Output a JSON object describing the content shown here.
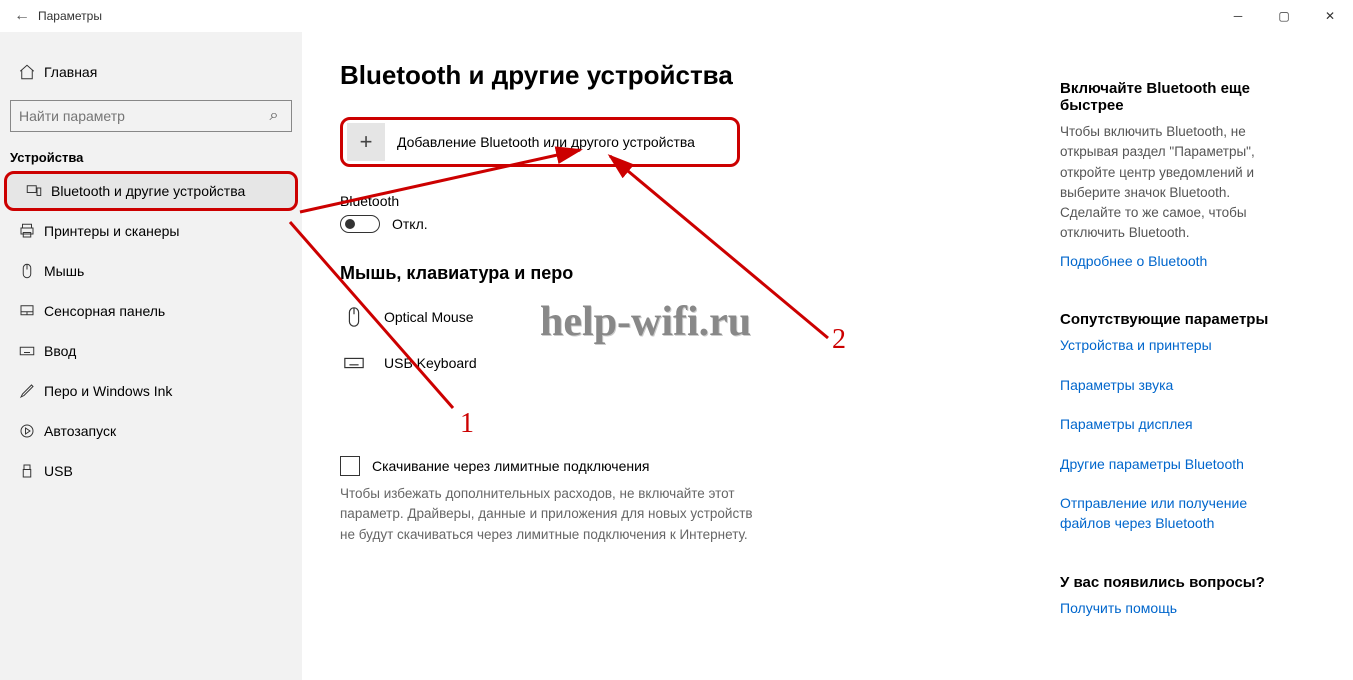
{
  "window": {
    "title": "Параметры"
  },
  "sidebar": {
    "home": "Главная",
    "search_placeholder": "Найти параметр",
    "category": "Устройства",
    "items": [
      {
        "label": "Bluetooth и другие устройства",
        "icon": "devices"
      },
      {
        "label": "Принтеры и сканеры",
        "icon": "printer"
      },
      {
        "label": "Мышь",
        "icon": "mouse"
      },
      {
        "label": "Сенсорная панель",
        "icon": "touchpad"
      },
      {
        "label": "Ввод",
        "icon": "keyboard"
      },
      {
        "label": "Перо и Windows Ink",
        "icon": "pen"
      },
      {
        "label": "Автозапуск",
        "icon": "autoplay"
      },
      {
        "label": "USB",
        "icon": "usb"
      }
    ]
  },
  "main": {
    "heading": "Bluetooth и другие устройства",
    "add_device": "Добавление Bluetooth или другого устройства",
    "bluetooth_label": "Bluetooth",
    "bluetooth_state": "Откл.",
    "group_title": "Мышь, клавиатура и перо",
    "devices": [
      {
        "name": "Optical Mouse",
        "icon": "mouse"
      },
      {
        "name": "USB Keyboard",
        "icon": "keyboard"
      }
    ],
    "checkbox_label": "Скачивание через лимитные подключения",
    "checkbox_help": "Чтобы избежать дополнительных расходов, не включайте этот параметр. Драйверы, данные и приложения для новых устройств не будут скачиваться через лимитные подключения к Интернету."
  },
  "right": {
    "s1_title": "Включайте Bluetooth еще быстрее",
    "s1_text": "Чтобы включить Bluetooth, не открывая раздел \"Параметры\", откройте центр уведомлений и выберите значок Bluetooth. Сделайте то же самое, чтобы отключить Bluetooth.",
    "s1_link": "Подробнее о Bluetooth",
    "s2_title": "Сопутствующие параметры",
    "s2_links": [
      "Устройства и принтеры",
      "Параметры звука",
      "Параметры дисплея",
      "Другие параметры Bluetooth",
      "Отправление или получение файлов через Bluetooth"
    ],
    "s3_title": "У вас появились вопросы?",
    "s3_link": "Получить помощь"
  },
  "annotation": {
    "marker1": "1",
    "marker2": "2",
    "watermark": "help-wifi.ru"
  }
}
